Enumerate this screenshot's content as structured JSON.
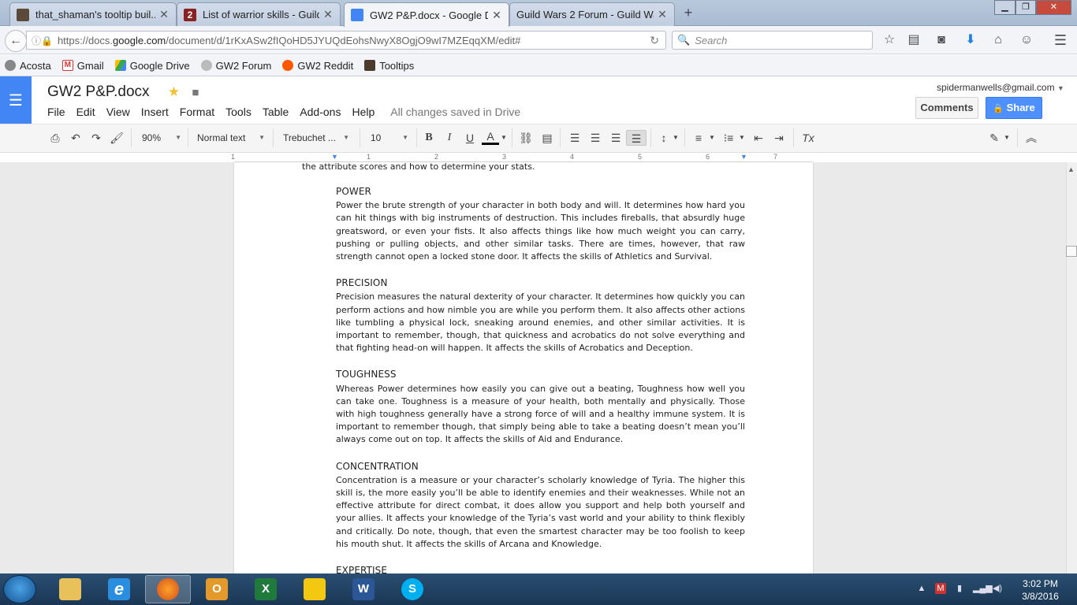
{
  "browser": {
    "tabs": [
      {
        "title": "that_shaman's tooltip buil...",
        "icon": "game-avatar-icon",
        "active": false
      },
      {
        "title": "List of warrior skills - Guild ...",
        "icon": "gw2-wiki-icon",
        "active": false
      },
      {
        "title": "GW2 P&P.docx - Google D...",
        "icon": "google-docs-icon",
        "active": true
      },
      {
        "title": "Guild Wars 2 Forum - Guild Wa...",
        "icon": "",
        "active": false
      }
    ],
    "new_tab_symbol": "+",
    "url": {
      "prefix": "https://docs.",
      "domain": "google.com",
      "path": "/document/d/1rKxASw2fIQoHD5JYUQdEohsNwyX8OgjO9wI7MZEqqXM/edit#"
    },
    "search_placeholder": "Search",
    "bookmarks": [
      {
        "label": "Acosta",
        "icon": "avatar-icon"
      },
      {
        "label": "Gmail",
        "icon": "gmail-icon"
      },
      {
        "label": "Google Drive",
        "icon": "drive-icon"
      },
      {
        "label": "GW2 Forum",
        "icon": "forum-icon"
      },
      {
        "label": "GW2 Reddit",
        "icon": "reddit-icon"
      },
      {
        "label": "Tooltips",
        "icon": "tooltip-icon"
      }
    ]
  },
  "docs": {
    "title": "GW2 P&P.docx",
    "menu": [
      "File",
      "Edit",
      "View",
      "Insert",
      "Format",
      "Tools",
      "Table",
      "Add-ons",
      "Help"
    ],
    "save_status": "All changes saved in Drive",
    "user_email": "spidermanwells@gmail.com",
    "comments_label": "Comments",
    "share_label": "Share",
    "toolbar": {
      "zoom": "90%",
      "style": "Normal text",
      "font": "Trebuchet ...",
      "size": "10"
    },
    "ruler_numbers": [
      "1",
      "1",
      "2",
      "3",
      "4",
      "5",
      "6",
      "7"
    ]
  },
  "document": {
    "lead_text": "the attribute scores and how to determine your stats.",
    "sections": [
      {
        "heading": "POWER",
        "body": "Power the brute strength of your character in both body and will. It determines how hard you can hit things with big instruments of destruction. This includes fireballs, that absurdly huge greatsword, or even your fists. It also affects things like how much weight you can carry, pushing or pulling objects, and other similar tasks. There are times, however, that raw strength cannot open a locked stone door. It affects the skills of Athletics and Survival."
      },
      {
        "heading": "PRECISION",
        "body": "Precision measures the natural dexterity of your character. It determines how quickly you can perform actions and how nimble you are while you perform them. It also affects other actions like tumbling a physical lock, sneaking around enemies, and other similar activities. It is important to remember, though, that quickness and acrobatics do not solve everything and that fighting head-on will happen. It affects the skills of Acrobatics and Deception."
      },
      {
        "heading": "TOUGHNESS",
        "body": "Whereas Power determines how easily you can give out a beating, Toughness how well you can take one. Toughness is a measure of your health, both mentally and physically. Those with high toughness generally have a strong force of will and a healthy immune system. It is important to remember though, that simply being able to take a beating doesn’t mean you’ll always come out on top. It affects the skills of Aid and Endurance."
      },
      {
        "heading": "CONCENTRATION",
        "body": "Concentration is a measure or your character’s scholarly knowledge of Tyria. The higher this skill is, the more easily you’ll be able to identify enemies and their weaknesses. While not an effective attribute for direct combat, it does allow you support and help both yourself and your allies. It affects your knowledge of the Tyria’s vast world and your ability to think flexibly and critically. Do note, though, that even the smartest character may be too foolish to keep his mouth shut. It affects the skills of Arcana and Knowledge."
      },
      {
        "heading": "EXPERTISE",
        "body": ""
      }
    ]
  },
  "taskbar": {
    "apps": [
      {
        "name": "explorer",
        "icon": "folder-icon",
        "label": ""
      },
      {
        "name": "internet-explorer",
        "icon": "ie-icon",
        "label": "e"
      },
      {
        "name": "firefox",
        "icon": "firefox-icon",
        "label": ""
      },
      {
        "name": "outlook",
        "icon": "outlook-icon",
        "label": "O"
      },
      {
        "name": "excel",
        "icon": "excel-icon",
        "label": "X"
      },
      {
        "name": "powerbi",
        "icon": "powerbi-icon",
        "label": ""
      },
      {
        "name": "word",
        "icon": "word-icon",
        "label": "W"
      },
      {
        "name": "skype",
        "icon": "skype-icon",
        "label": "S"
      }
    ],
    "time": "3:02 PM",
    "date": "3/8/2016"
  }
}
